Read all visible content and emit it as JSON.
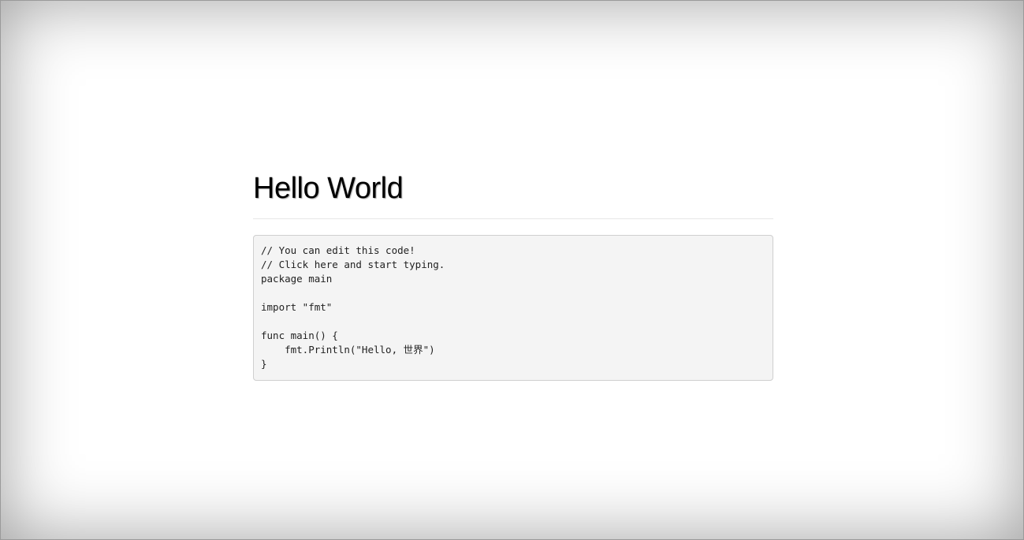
{
  "page": {
    "title": "Hello World"
  },
  "code": {
    "lines": [
      "// You can edit this code!",
      "// Click here and start typing.",
      "package main",
      "",
      "import \"fmt\"",
      "",
      "func main() {",
      "    fmt.Println(\"Hello, 世界\")",
      "}"
    ]
  },
  "colors": {
    "background": "#ffffff",
    "code_background": "#f4f4f4",
    "code_border": "#cfcfcf",
    "divider": "#e7e7e7"
  }
}
